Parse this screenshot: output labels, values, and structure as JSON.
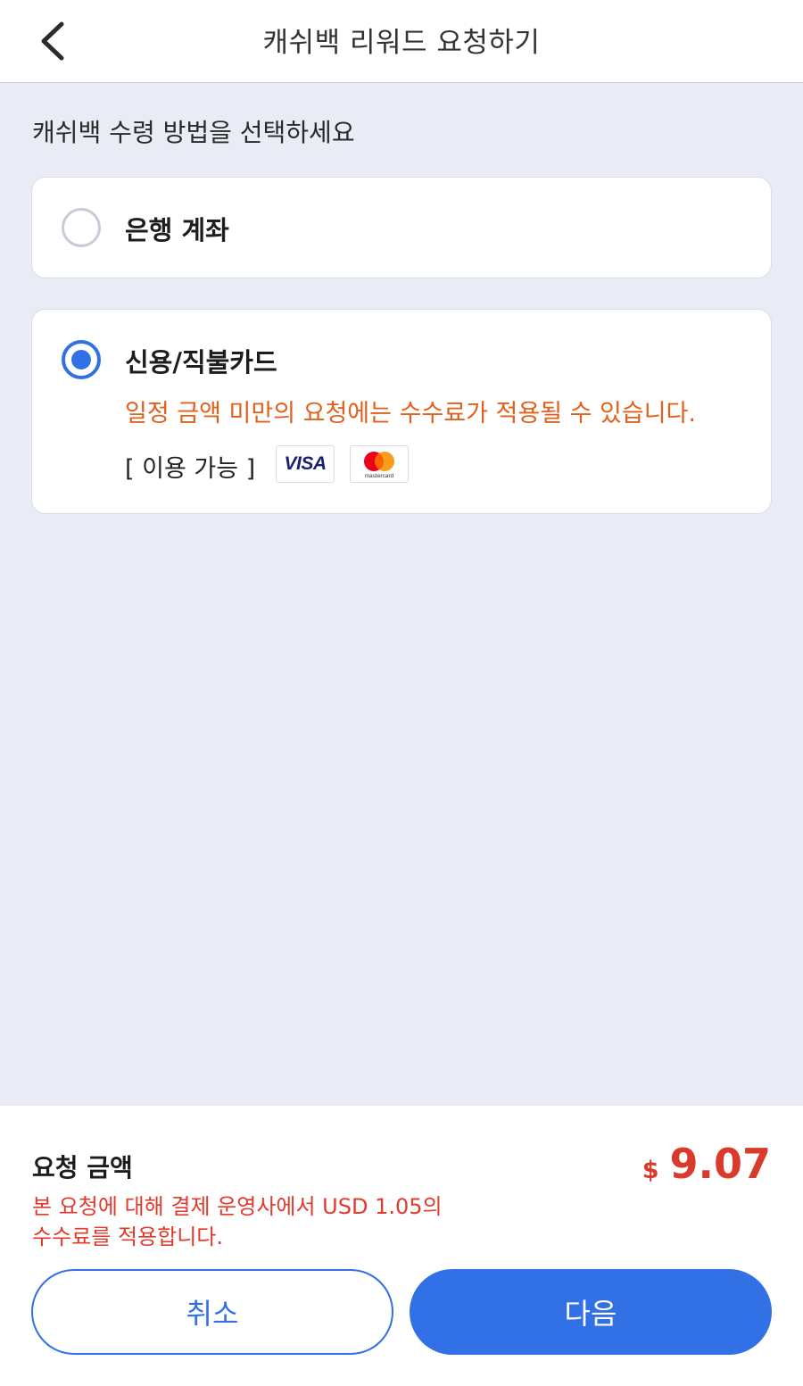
{
  "header": {
    "title": "캐쉬백 리워드 요청하기",
    "back_icon": "chevron-left-icon"
  },
  "main": {
    "section_label": "캐쉬백 수령 방법을 선택하세요",
    "options": [
      {
        "label": "은행 계좌",
        "selected": false
      },
      {
        "label": "신용/직불카드",
        "selected": true,
        "fee_warning": "일정 금액 미만의 요청에는 수수료가 적용될 수 있습니다.",
        "available_label": "[ 이용 가능 ]",
        "card_brands": {
          "visa": "VISA",
          "mastercard": "mastercard"
        }
      }
    ]
  },
  "summary": {
    "amount_label": "요청 금액",
    "currency_symbol": "$",
    "amount": "9.07",
    "fee_note_line1": "본 요청에 대해 결제 운영사에서 USD 1.05의",
    "fee_note_line2": "수수료를 적용합니다."
  },
  "actions": {
    "cancel_label": "취소",
    "next_label": "다음"
  },
  "colors": {
    "accent": "#3270e6",
    "warning": "#e2601c",
    "amount": "#d93a2b",
    "background": "#e9ecf4"
  }
}
